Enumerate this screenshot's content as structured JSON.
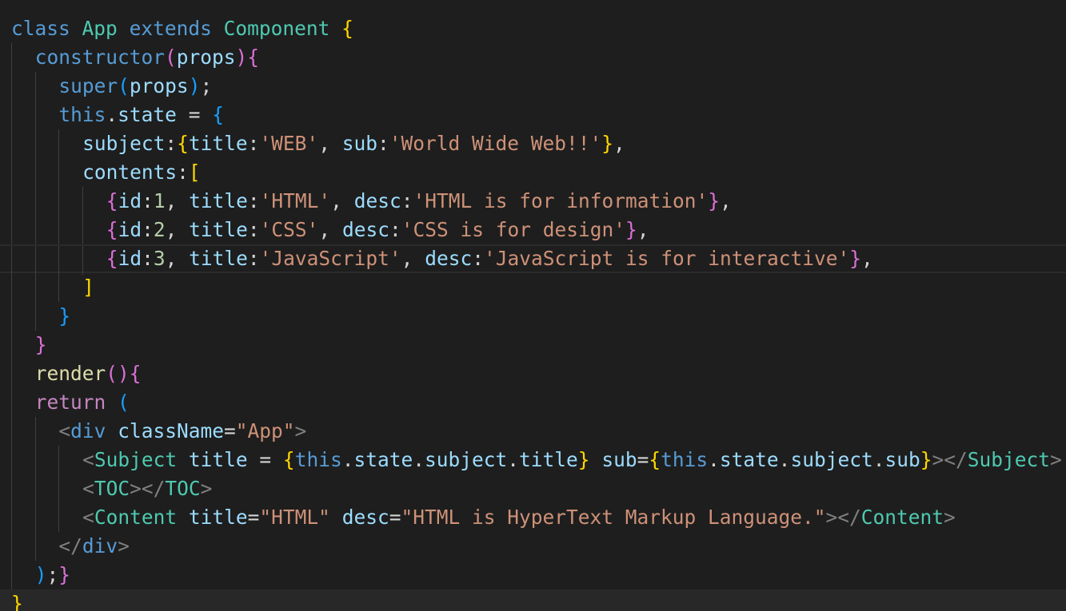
{
  "editor": {
    "language": "javascript",
    "theme_colors": {
      "background": "#1e1e1e",
      "keyword": "#569cd6",
      "control": "#c586c0",
      "class": "#4ec9b0",
      "function": "#dcdcaa",
      "property": "#9cdcfe",
      "string": "#ce9178",
      "number": "#b5cea8",
      "bracket_level_1": "#ffd700",
      "bracket_level_2": "#da70d6",
      "bracket_level_3": "#179fff"
    },
    "lines": [
      {
        "indent": 0,
        "tokens": [
          {
            "t": "class",
            "c": "kw"
          },
          {
            "t": " ",
            "c": "pun"
          },
          {
            "t": "App",
            "c": "cls"
          },
          {
            "t": " ",
            "c": "pun"
          },
          {
            "t": "extends",
            "c": "kw"
          },
          {
            "t": " ",
            "c": "pun"
          },
          {
            "t": "Component",
            "c": "cls"
          },
          {
            "t": " ",
            "c": "pun"
          },
          {
            "t": "{",
            "c": "b1"
          }
        ]
      },
      {
        "indent": 1,
        "tokens": [
          {
            "t": "constructor",
            "c": "kw"
          },
          {
            "t": "(",
            "c": "b2"
          },
          {
            "t": "props",
            "c": "prop"
          },
          {
            "t": ")",
            "c": "b2"
          },
          {
            "t": "{",
            "c": "b2"
          }
        ]
      },
      {
        "indent": 2,
        "tokens": [
          {
            "t": "super",
            "c": "kw"
          },
          {
            "t": "(",
            "c": "b3"
          },
          {
            "t": "props",
            "c": "prop"
          },
          {
            "t": ")",
            "c": "b3"
          },
          {
            "t": ";",
            "c": "pun"
          }
        ]
      },
      {
        "indent": 2,
        "tokens": [
          {
            "t": "this",
            "c": "kw"
          },
          {
            "t": ".",
            "c": "pun"
          },
          {
            "t": "state",
            "c": "prop"
          },
          {
            "t": " = ",
            "c": "pun"
          },
          {
            "t": "{",
            "c": "b3"
          }
        ]
      },
      {
        "indent": 3,
        "tokens": [
          {
            "t": "subject",
            "c": "prop"
          },
          {
            "t": ":",
            "c": "pun"
          },
          {
            "t": "{",
            "c": "b1"
          },
          {
            "t": "title",
            "c": "prop"
          },
          {
            "t": ":",
            "c": "pun"
          },
          {
            "t": "'WEB'",
            "c": "str"
          },
          {
            "t": ", ",
            "c": "pun"
          },
          {
            "t": "sub",
            "c": "prop"
          },
          {
            "t": ":",
            "c": "pun"
          },
          {
            "t": "'World Wide Web!!'",
            "c": "str"
          },
          {
            "t": "}",
            "c": "b1"
          },
          {
            "t": ",",
            "c": "pun"
          }
        ]
      },
      {
        "indent": 3,
        "tokens": [
          {
            "t": "contents",
            "c": "prop"
          },
          {
            "t": ":",
            "c": "pun"
          },
          {
            "t": "[",
            "c": "b1"
          }
        ]
      },
      {
        "indent": 4,
        "tokens": [
          {
            "t": "{",
            "c": "b2"
          },
          {
            "t": "id",
            "c": "prop"
          },
          {
            "t": ":",
            "c": "pun"
          },
          {
            "t": "1",
            "c": "num"
          },
          {
            "t": ", ",
            "c": "pun"
          },
          {
            "t": "title",
            "c": "prop"
          },
          {
            "t": ":",
            "c": "pun"
          },
          {
            "t": "'HTML'",
            "c": "str"
          },
          {
            "t": ", ",
            "c": "pun"
          },
          {
            "t": "desc",
            "c": "prop"
          },
          {
            "t": ":",
            "c": "pun"
          },
          {
            "t": "'HTML is for information'",
            "c": "str"
          },
          {
            "t": "}",
            "c": "b2"
          },
          {
            "t": ",",
            "c": "pun"
          }
        ]
      },
      {
        "indent": 4,
        "tokens": [
          {
            "t": "{",
            "c": "b2"
          },
          {
            "t": "id",
            "c": "prop"
          },
          {
            "t": ":",
            "c": "pun"
          },
          {
            "t": "2",
            "c": "num"
          },
          {
            "t": ", ",
            "c": "pun"
          },
          {
            "t": "title",
            "c": "prop"
          },
          {
            "t": ":",
            "c": "pun"
          },
          {
            "t": "'CSS'",
            "c": "str"
          },
          {
            "t": ", ",
            "c": "pun"
          },
          {
            "t": "desc",
            "c": "prop"
          },
          {
            "t": ":",
            "c": "pun"
          },
          {
            "t": "'CSS is for design'",
            "c": "str"
          },
          {
            "t": "}",
            "c": "b2"
          },
          {
            "t": ",",
            "c": "pun"
          }
        ]
      },
      {
        "indent": 4,
        "current": true,
        "tokens": [
          {
            "t": "{",
            "c": "b2"
          },
          {
            "t": "id",
            "c": "prop"
          },
          {
            "t": ":",
            "c": "pun"
          },
          {
            "t": "3",
            "c": "num"
          },
          {
            "t": ", ",
            "c": "pun"
          },
          {
            "t": "title",
            "c": "prop"
          },
          {
            "t": ":",
            "c": "pun"
          },
          {
            "t": "'JavaScript'",
            "c": "str"
          },
          {
            "t": ", ",
            "c": "pun"
          },
          {
            "t": "desc",
            "c": "prop"
          },
          {
            "t": ":",
            "c": "pun"
          },
          {
            "t": "'JavaScript is for interactive'",
            "c": "str"
          },
          {
            "t": "}",
            "c": "b2"
          },
          {
            "t": ",",
            "c": "pun"
          }
        ]
      },
      {
        "indent": 3,
        "tokens": [
          {
            "t": "]",
            "c": "b1"
          }
        ]
      },
      {
        "indent": 2,
        "tokens": [
          {
            "t": "}",
            "c": "b3"
          }
        ]
      },
      {
        "indent": 1,
        "tokens": [
          {
            "t": "}",
            "c": "b2"
          }
        ]
      },
      {
        "indent": 1,
        "tokens": [
          {
            "t": "render",
            "c": "fn"
          },
          {
            "t": "(",
            "c": "b2"
          },
          {
            "t": ")",
            "c": "b2"
          },
          {
            "t": "{",
            "c": "b2"
          }
        ]
      },
      {
        "indent": 1,
        "tokens": [
          {
            "t": "return",
            "c": "ctl"
          },
          {
            "t": " ",
            "c": "pun"
          },
          {
            "t": "(",
            "c": "b3"
          }
        ]
      },
      {
        "indent": 2,
        "tokens": [
          {
            "t": "<",
            "c": "ang"
          },
          {
            "t": "div",
            "c": "tag"
          },
          {
            "t": " ",
            "c": "pun"
          },
          {
            "t": "className",
            "c": "prop"
          },
          {
            "t": "=",
            "c": "pun"
          },
          {
            "t": "\"App\"",
            "c": "str"
          },
          {
            "t": ">",
            "c": "ang"
          }
        ]
      },
      {
        "indent": 3,
        "tokens": [
          {
            "t": "<",
            "c": "ang"
          },
          {
            "t": "Subject",
            "c": "cls"
          },
          {
            "t": " ",
            "c": "pun"
          },
          {
            "t": "title",
            "c": "prop"
          },
          {
            "t": " = ",
            "c": "pun"
          },
          {
            "t": "{",
            "c": "b1"
          },
          {
            "t": "this",
            "c": "kw"
          },
          {
            "t": ".",
            "c": "pun"
          },
          {
            "t": "state",
            "c": "prop"
          },
          {
            "t": ".",
            "c": "pun"
          },
          {
            "t": "subject",
            "c": "prop"
          },
          {
            "t": ".",
            "c": "pun"
          },
          {
            "t": "title",
            "c": "prop"
          },
          {
            "t": "}",
            "c": "b1"
          },
          {
            "t": " ",
            "c": "pun"
          },
          {
            "t": "sub",
            "c": "prop"
          },
          {
            "t": "=",
            "c": "pun"
          },
          {
            "t": "{",
            "c": "b1"
          },
          {
            "t": "this",
            "c": "kw"
          },
          {
            "t": ".",
            "c": "pun"
          },
          {
            "t": "state",
            "c": "prop"
          },
          {
            "t": ".",
            "c": "pun"
          },
          {
            "t": "subject",
            "c": "prop"
          },
          {
            "t": ".",
            "c": "pun"
          },
          {
            "t": "sub",
            "c": "prop"
          },
          {
            "t": "}",
            "c": "b1"
          },
          {
            "t": "></",
            "c": "ang"
          },
          {
            "t": "Subject",
            "c": "cls"
          },
          {
            "t": ">",
            "c": "ang"
          }
        ]
      },
      {
        "indent": 3,
        "tokens": [
          {
            "t": "<",
            "c": "ang"
          },
          {
            "t": "TOC",
            "c": "cls"
          },
          {
            "t": "></",
            "c": "ang"
          },
          {
            "t": "TOC",
            "c": "cls"
          },
          {
            "t": ">",
            "c": "ang"
          }
        ]
      },
      {
        "indent": 3,
        "tokens": [
          {
            "t": "<",
            "c": "ang"
          },
          {
            "t": "Content",
            "c": "cls"
          },
          {
            "t": " ",
            "c": "pun"
          },
          {
            "t": "title",
            "c": "prop"
          },
          {
            "t": "=",
            "c": "pun"
          },
          {
            "t": "\"HTML\"",
            "c": "str"
          },
          {
            "t": " ",
            "c": "pun"
          },
          {
            "t": "desc",
            "c": "prop"
          },
          {
            "t": "=",
            "c": "pun"
          },
          {
            "t": "\"HTML is HyperText Markup Language.\"",
            "c": "str"
          },
          {
            "t": "></",
            "c": "ang"
          },
          {
            "t": "Content",
            "c": "cls"
          },
          {
            "t": ">",
            "c": "ang"
          }
        ]
      },
      {
        "indent": 2,
        "tokens": [
          {
            "t": "</",
            "c": "ang"
          },
          {
            "t": "div",
            "c": "tag"
          },
          {
            "t": ">",
            "c": "ang"
          }
        ]
      },
      {
        "indent": 1,
        "tokens": [
          {
            "t": ")",
            "c": "b3"
          },
          {
            "t": ";",
            "c": "pun"
          },
          {
            "t": "}",
            "c": "b2"
          }
        ]
      },
      {
        "indent": 0,
        "last": true,
        "tokens": [
          {
            "t": "}",
            "c": "b1"
          }
        ]
      }
    ]
  }
}
